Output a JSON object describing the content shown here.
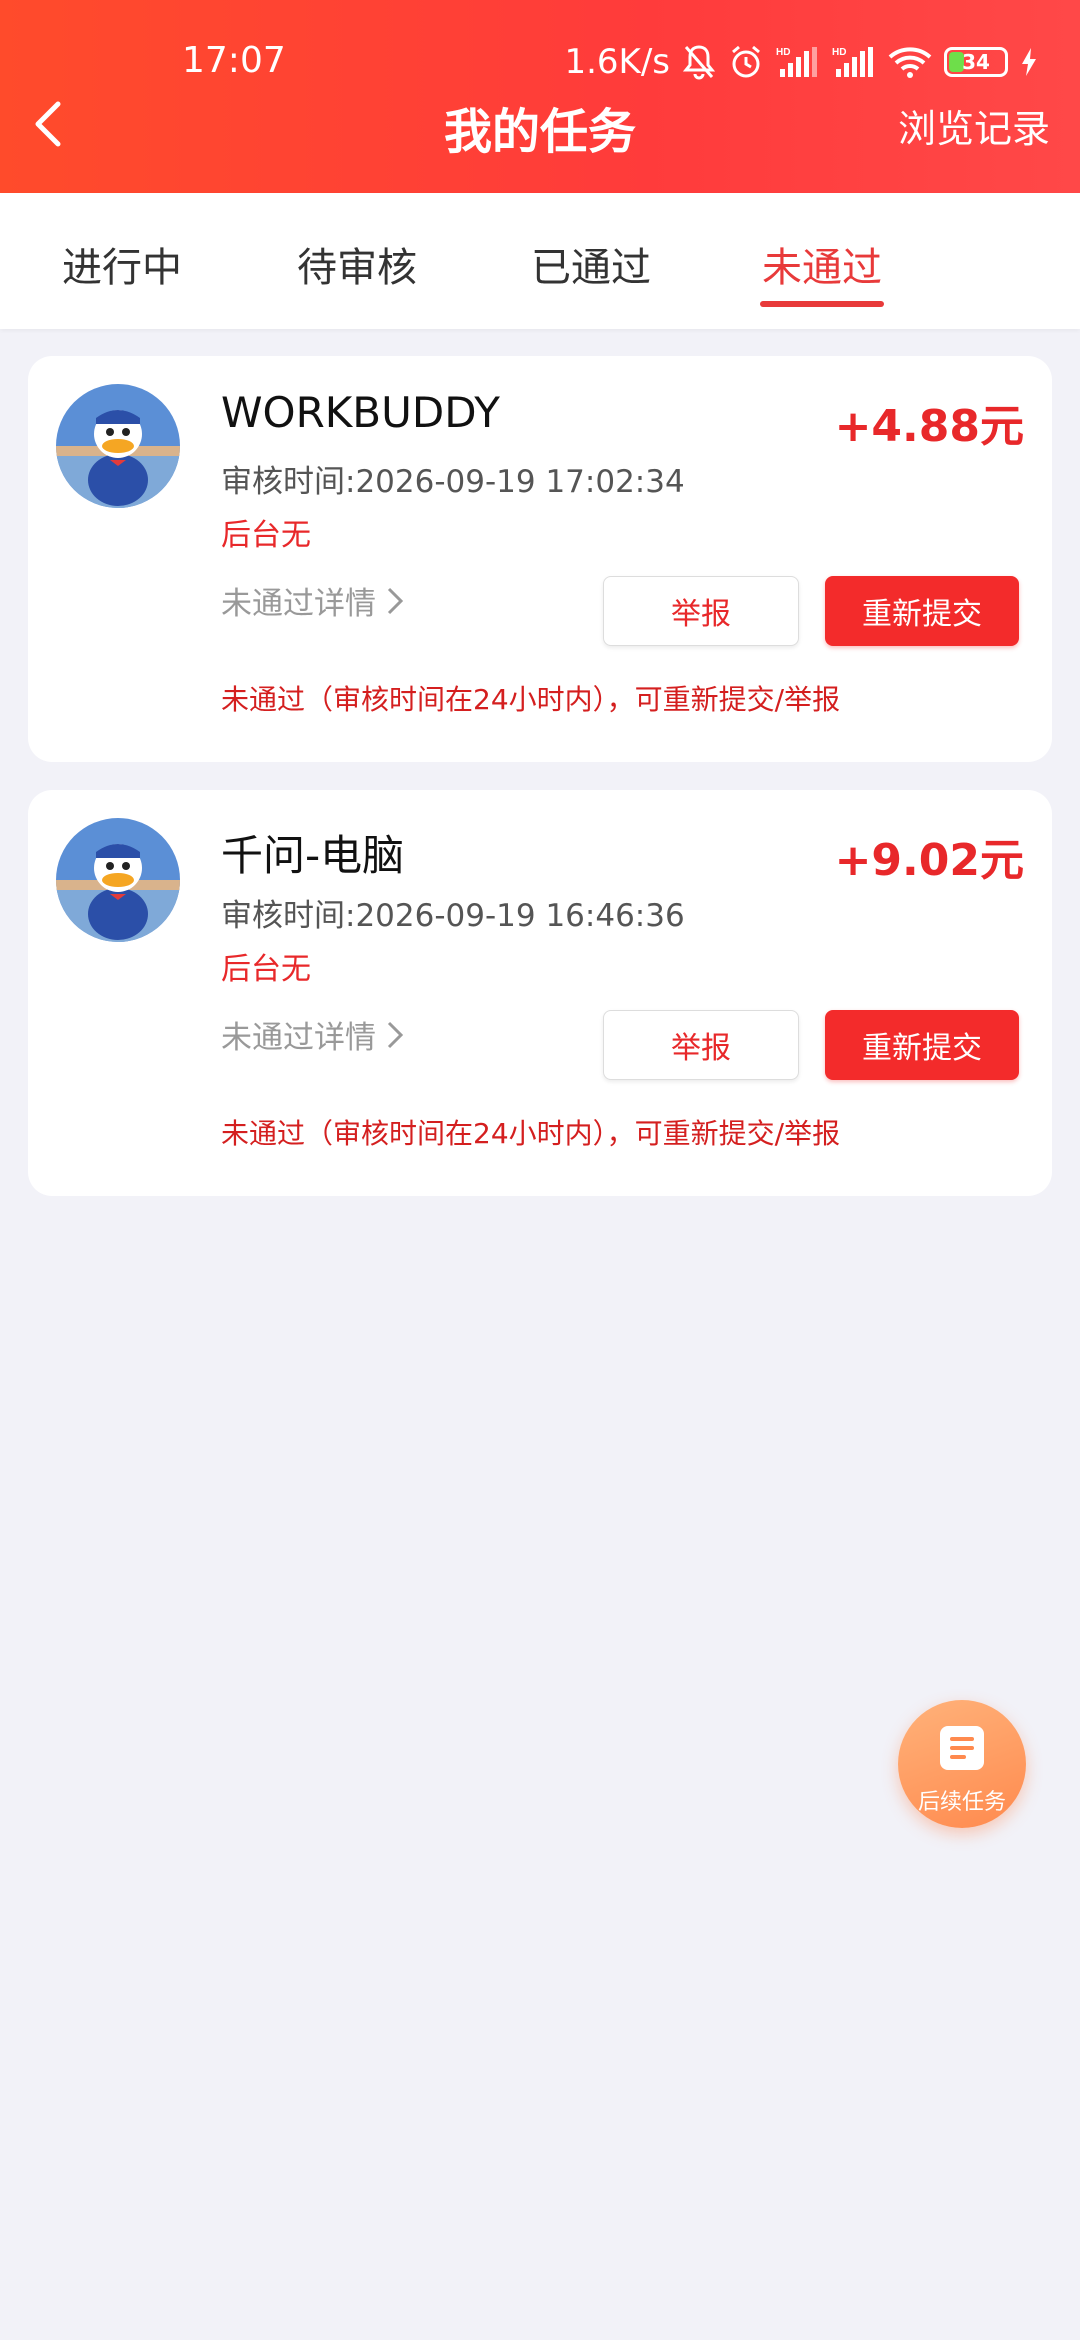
{
  "status_bar": {
    "time": "17:07",
    "network_speed": "1.6K/s",
    "battery_level": "34"
  },
  "header": {
    "title": "我的任务",
    "history_link": "浏览记录"
  },
  "tabs": [
    {
      "label": "进行中"
    },
    {
      "label": "待审核"
    },
    {
      "label": "已通过"
    },
    {
      "label": "未通过",
      "active": true
    }
  ],
  "tasks": [
    {
      "title": "WORKBUDDY",
      "reward": "+4.88元",
      "review_time": "审核时间:2026-09-19 17:02:34",
      "status": "后台无",
      "detail_link": "未通过详情",
      "report_label": "举报",
      "resubmit_label": "重新提交",
      "note": "未通过（审核时间在24小时内），可重新提交/举报"
    },
    {
      "title": "千问-电脑",
      "reward": "+9.02元",
      "review_time": "审核时间:2026-09-19 16:46:36",
      "status": "后台无",
      "detail_link": "未通过详情",
      "report_label": "举报",
      "resubmit_label": "重新提交",
      "note": "未通过（审核时间在24小时内），可重新提交/举报"
    }
  ],
  "fab": {
    "label": "后续任务"
  },
  "colors": {
    "accent": "#e83a3a",
    "header": "#ff4040",
    "reward": "#e8282a"
  }
}
